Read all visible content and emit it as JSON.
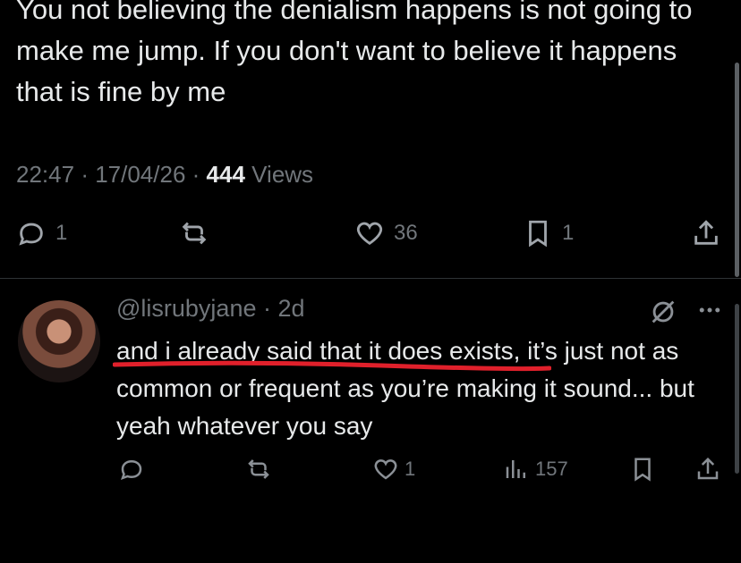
{
  "tweet": {
    "text": "You not believing the denialism happens is not going to make me jump. If you don't want to believe it happens that is fine by me",
    "time": "22:47",
    "date": "17/04/26",
    "views_count": "444",
    "views_label": "Views",
    "replies": "1",
    "likes": "36",
    "bookmarks": "1"
  },
  "reply": {
    "handle": "@lisrubyjane",
    "age": "2d",
    "text": "and i already said that it does exists, it’s just not as common or frequent as you’re making it sound... but yeah whatever you say",
    "likes": "1",
    "views": "157"
  },
  "colors": {
    "underline": "#e0202b",
    "muted": "#71767b"
  }
}
